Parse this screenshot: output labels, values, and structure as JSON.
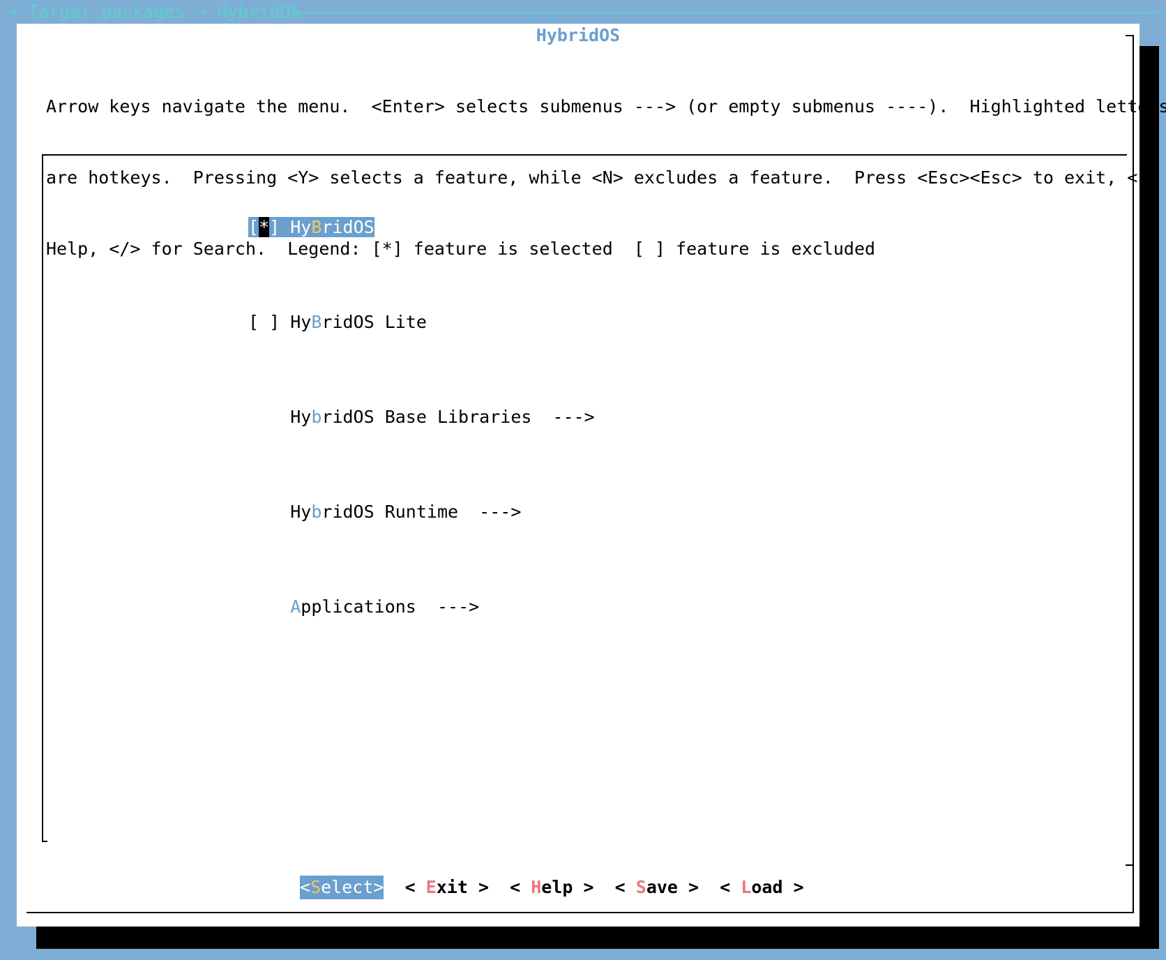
{
  "breadcrumb": {
    "arrow1": "→",
    "item1": "Target packages",
    "arrow2": "→",
    "item2": "HybridOS"
  },
  "dialog": {
    "title": "HybridOS",
    "instructions": [
      "Arrow keys navigate the menu.  <Enter> selects submenus ---> (or empty submenus ----).  Highlighted letters",
      "are hotkeys.  Pressing <Y> selects a feature, while <N> excludes a feature.  Press <Esc><Esc> to exit, <?> for",
      "Help, </> for Search.  Legend: [*] feature is selected  [ ] feature is excluded"
    ]
  },
  "menu": {
    "items": [
      {
        "prefix_open": "[",
        "prefix_mark": "*",
        "prefix_close": "]",
        "pre": "Hy",
        "hotkey": "B",
        "post": "ridOS",
        "suffix": "",
        "selected": true
      },
      {
        "prefix_open": "[",
        "prefix_mark": " ",
        "prefix_close": "]",
        "pre": "Hy",
        "hotkey": "B",
        "post": "ridOS Lite",
        "suffix": ""
      },
      {
        "prefix": "    ",
        "pre": "Hy",
        "hotkey": "b",
        "post": "ridOS Base Libraries",
        "suffix": "  --->"
      },
      {
        "prefix": "    ",
        "pre": "Hy",
        "hotkey": "b",
        "post": "ridOS Runtime",
        "suffix": "  --->"
      },
      {
        "prefix": "    ",
        "pre": "",
        "hotkey": "A",
        "post": "pplications",
        "suffix": "  --->"
      }
    ]
  },
  "buttons": {
    "select": {
      "open": "<",
      "hotkey": "S",
      "rest": "elect",
      "close": ">"
    },
    "exit": {
      "open": "< ",
      "hotkey": "E",
      "rest": "xit",
      "close": " >"
    },
    "help": {
      "open": "< ",
      "hotkey": "H",
      "rest": "elp",
      "close": " >"
    },
    "save": {
      "open": "< ",
      "hotkey": "S",
      "rest": "ave",
      "close": " >"
    },
    "load": {
      "open": "< ",
      "hotkey": "L",
      "rest": "oad",
      "close": " >"
    }
  },
  "colors": {
    "background": "#7eaed6",
    "highlight": "#6a9fcf",
    "breadcrumb": "#5bd0c8",
    "hotkey_selected": "#f2c56b",
    "hotkey_button": "#e8787f"
  }
}
